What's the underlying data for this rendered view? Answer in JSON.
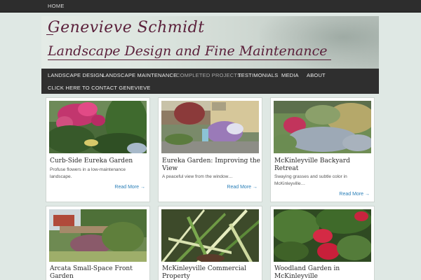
{
  "topbar": {
    "home": "HOME"
  },
  "header": {
    "site_name": "Genevieve Schmidt",
    "tagline": "Landscape Design and Fine Maintenance"
  },
  "nav": {
    "items": [
      "LANDSCAPE DESIGN",
      "LANDSCAPE MAINTENANCE",
      "COMPLETED PROJECTS",
      "TESTIMONIALS",
      "MEDIA",
      "ABOUT",
      "CLICK HERE TO CONTACT GENEVIEVE"
    ],
    "active": "COMPLETED PROJECTS"
  },
  "posts": [
    {
      "title": "Curb-Side Eureka Garden",
      "excerpt": "Profuse flowers in a low-maintenance landscape.",
      "more": "Read More →"
    },
    {
      "title": "Eureka Garden: Improving the View",
      "excerpt": "A peaceful view from the window…",
      "more": "Read More →"
    },
    {
      "title": "McKinleyville Backyard Retreat",
      "excerpt": "Swaying grasses and subtle color in McKinleyville…",
      "more": "Read More →"
    },
    {
      "title": "Arcata Small-Space Front Garden",
      "excerpt": "",
      "more": ""
    },
    {
      "title": "McKinleyville Commercial Property",
      "excerpt": "",
      "more": ""
    },
    {
      "title": "Woodland Garden in McKinleyville",
      "excerpt": "",
      "more": ""
    }
  ],
  "colors": {
    "page_bg": "#dfe8e4",
    "header_text": "#5a1f3a",
    "nav_bg": "#2f2f2f",
    "link": "#2a7fb8"
  }
}
